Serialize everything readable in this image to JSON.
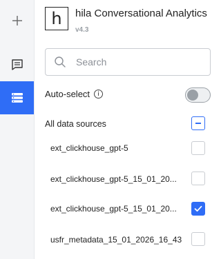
{
  "app": {
    "logo_letter": "h",
    "title": "hila Conversational Analytics",
    "version": "v4.3"
  },
  "rail": [
    {
      "icon": "plus-icon"
    },
    {
      "icon": "chat-icon"
    },
    {
      "icon": "database-icon",
      "active": true
    }
  ],
  "search": {
    "placeholder": "Search",
    "value": ""
  },
  "auto_select": {
    "label": "Auto-select",
    "info_glyph": "i",
    "enabled": false
  },
  "all_sources": {
    "label": "All data sources",
    "state": "partial"
  },
  "sources": [
    {
      "label": "ext_clickhouse_gpt-5",
      "checked": false
    },
    {
      "label": "ext_clickhouse_gpt-5_15_01_20...",
      "checked": false
    },
    {
      "label": "ext_clickhouse_gpt-5_15_01_20...",
      "checked": true
    },
    {
      "label": "usfr_metadata_15_01_2026_16_43",
      "checked": false
    }
  ],
  "colors": {
    "accent": "#2f6df6",
    "rail_bg": "#f4f5f7"
  }
}
